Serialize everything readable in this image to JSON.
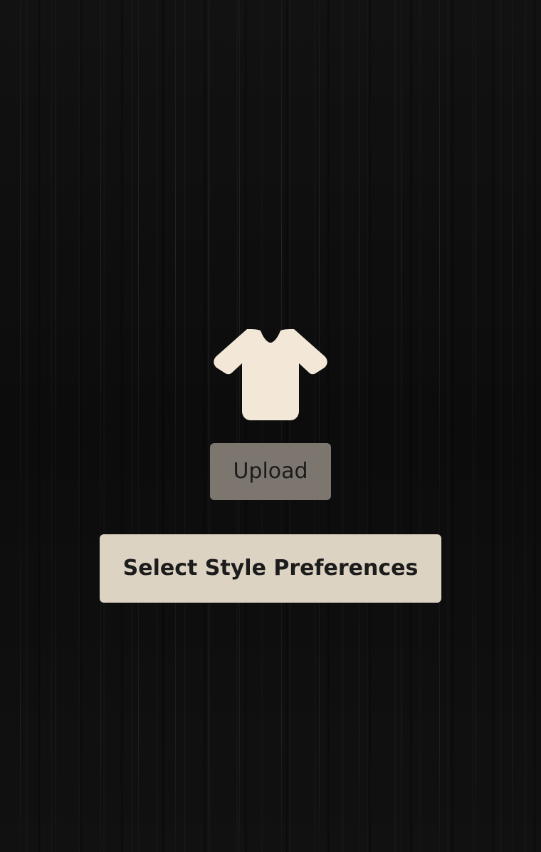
{
  "screen": {
    "background_color": "#0d0d0d"
  },
  "shirt_icon": {
    "icon": "tshirt-icon",
    "color": "#f3e8d8"
  },
  "upload_button": {
    "label": "Upload",
    "background_color": "#7c766e"
  },
  "style_button": {
    "label": "Select Style Preferences",
    "background_color": "#ddd3c3"
  }
}
